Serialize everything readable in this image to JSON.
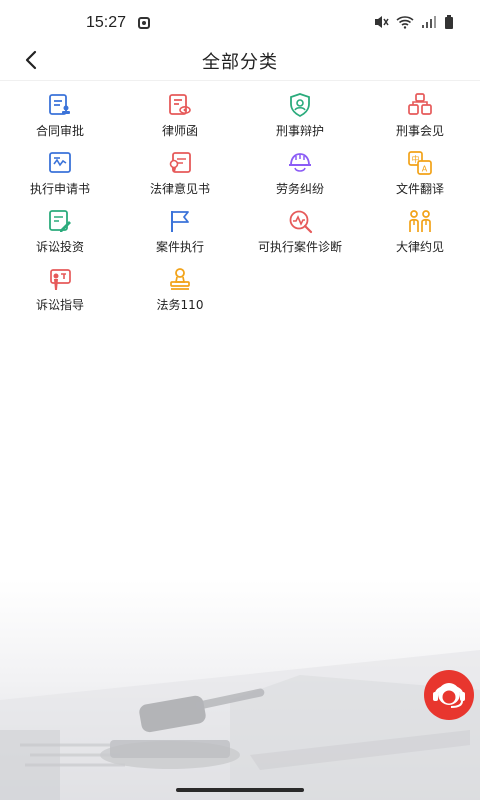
{
  "status": {
    "time": "15:27",
    "icons": [
      "app-notification-icon",
      "mute-icon",
      "wifi-icon",
      "signal-icon",
      "battery-icon"
    ]
  },
  "header": {
    "title": "全部分类",
    "back_icon": "chevron-left-icon"
  },
  "categories": [
    {
      "label": "合同审批",
      "icon": "contract-approval-icon",
      "color": "#3b73d9"
    },
    {
      "label": "律师函",
      "icon": "lawyer-letter-icon",
      "color": "#e65a5a"
    },
    {
      "label": "刑事辩护",
      "icon": "shield-user-icon",
      "color": "#2bab7c"
    },
    {
      "label": "刑事会见",
      "icon": "meeting-icon",
      "color": "#e65a5a"
    },
    {
      "label": "执行申请书",
      "icon": "application-form-icon",
      "color": "#3b73d9"
    },
    {
      "label": "法律意见书",
      "icon": "legal-opinion-icon",
      "color": "#e65a5a"
    },
    {
      "label": "劳务纠纷",
      "icon": "worker-helmet-icon",
      "color": "#8b5cf6"
    },
    {
      "label": "文件翻译",
      "icon": "translate-icon",
      "color": "#f2a319"
    },
    {
      "label": "诉讼投资",
      "icon": "litigation-investment-icon",
      "color": "#2bab7c"
    },
    {
      "label": "案件执行",
      "icon": "flag-icon",
      "color": "#3b73d9"
    },
    {
      "label": "可执行案件诊断",
      "icon": "diagnosis-icon",
      "color": "#e65a5a"
    },
    {
      "label": "大律约见",
      "icon": "two-people-icon",
      "color": "#f2a319"
    },
    {
      "label": "诉讼指导",
      "icon": "guidance-icon",
      "color": "#e65a5a"
    },
    {
      "label": "法务110",
      "icon": "stamp-icon",
      "color": "#f2a319"
    }
  ],
  "floating": {
    "icon": "customer-service-icon",
    "color": "#e8362e"
  }
}
